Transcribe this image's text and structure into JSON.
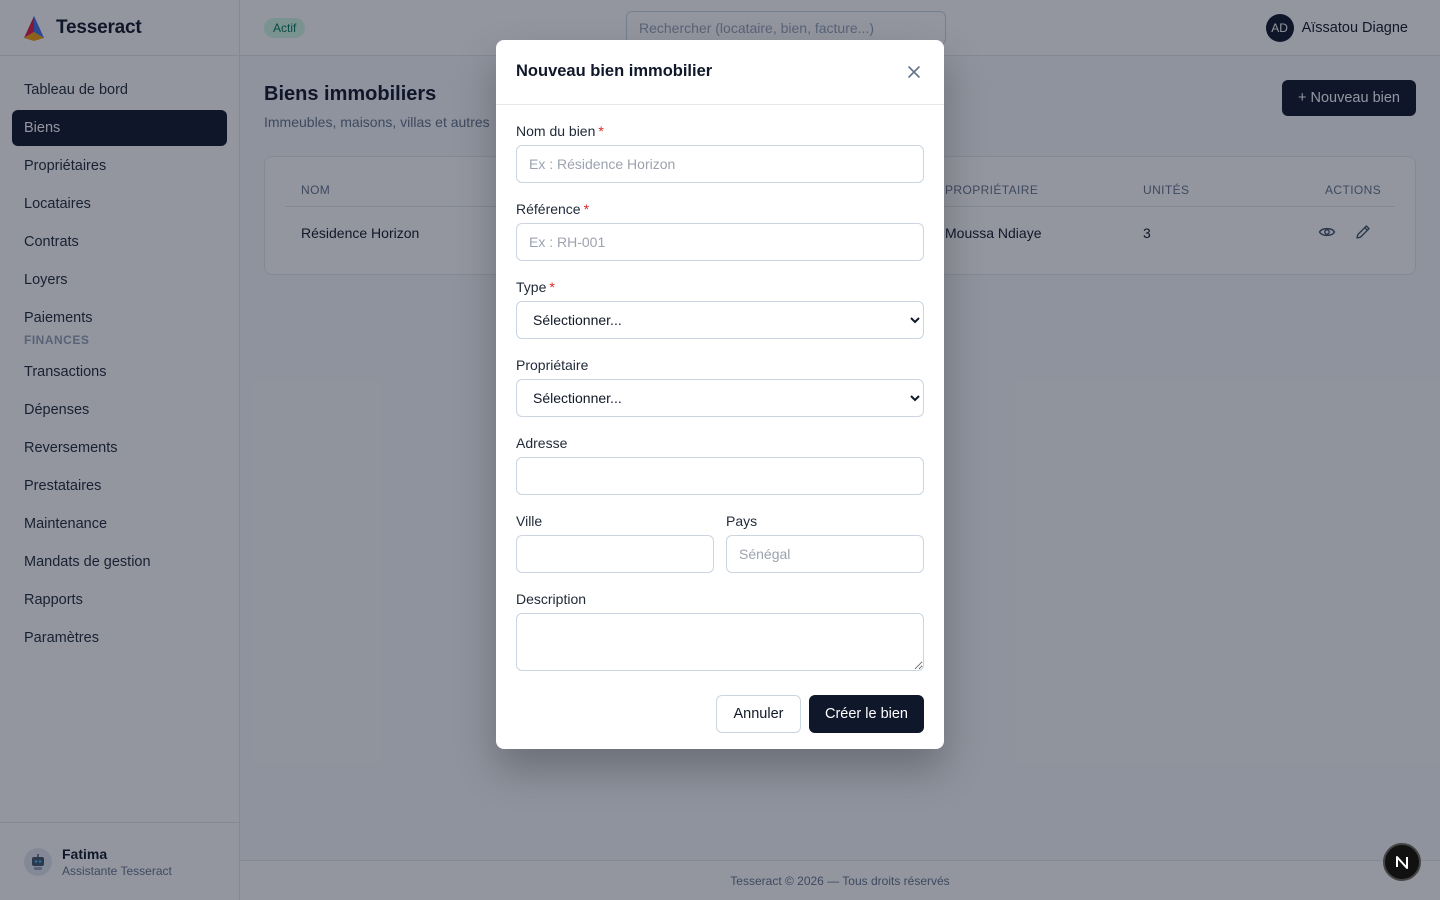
{
  "app": {
    "name": "Tesseract"
  },
  "sidebar": {
    "items": [
      {
        "label": "Tableau de bord"
      },
      {
        "label": "Biens"
      },
      {
        "label": "Propriétaires"
      },
      {
        "label": "Locataires"
      },
      {
        "label": "Contrats"
      },
      {
        "label": "Loyers"
      },
      {
        "label": "Paiements"
      }
    ],
    "finance_section": "FINANCES",
    "finance_items": [
      {
        "label": "Transactions"
      },
      {
        "label": "Dépenses"
      },
      {
        "label": "Reversements"
      },
      {
        "label": "Prestataires"
      },
      {
        "label": "Maintenance"
      },
      {
        "label": "Mandats de gestion"
      },
      {
        "label": "Rapports"
      },
      {
        "label": "Paramètres"
      }
    ],
    "assistant": {
      "name": "Fatima",
      "role": "Assistante Tesseract"
    }
  },
  "header": {
    "status": "Actif",
    "search_placeholder": "Rechercher (locataire, bien, facture...)",
    "user": {
      "initials": "AD",
      "name": "Aïssatou Diagne"
    }
  },
  "page": {
    "title": "Biens immobiliers",
    "subtitle": "Immeubles, maisons, villas et autres",
    "new_button": "+ Nouveau bien"
  },
  "table": {
    "columns": [
      "NOM",
      "PROPRIÉTAIRE",
      "UNITÉS",
      "ACTIONS"
    ],
    "rows": [
      {
        "name": "Résidence Horizon",
        "owner": "Moussa Ndiaye",
        "units": "3"
      }
    ]
  },
  "footer": {
    "text": "Tesseract © 2026 — Tous droits réservés"
  },
  "fab": {
    "label": "N"
  },
  "modal": {
    "title": "Nouveau bien immobilier",
    "fields": {
      "name": {
        "label": "Nom du bien",
        "required": "*",
        "placeholder": "Ex : Résidence Horizon",
        "value": ""
      },
      "reference": {
        "label": "Référence",
        "required": "*",
        "placeholder": "Ex : RH-001",
        "value": ""
      },
      "type": {
        "label": "Type",
        "required": "*",
        "selected": "Sélectionner..."
      },
      "owner": {
        "label": "Propriétaire",
        "selected": "Sélectionner..."
      },
      "address": {
        "label": "Adresse",
        "value": ""
      },
      "city": {
        "label": "Ville",
        "value": ""
      },
      "country": {
        "label": "Pays",
        "placeholder": "Sénégal",
        "value": ""
      },
      "description": {
        "label": "Description",
        "value": ""
      }
    },
    "cancel_label": "Annuler",
    "submit_label": "Créer le bien"
  },
  "colors": {
    "primary": "#0f172a",
    "required": "#dc2626",
    "badge_bg": "#d1fae5",
    "badge_text": "#047857",
    "overlay": "rgba(15, 23, 42, 0.45)"
  },
  "icons": {
    "logo": "tesseract-logo",
    "close": "close-icon",
    "view": "eye-icon",
    "edit": "pencil-icon",
    "assistant": "robot-icon"
  }
}
